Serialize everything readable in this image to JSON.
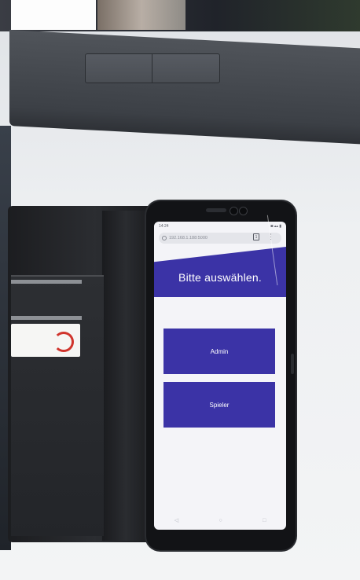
{
  "browser": {
    "url": "192.168.1.188:5000",
    "tab_count": "1",
    "menu_glyph": "⋮",
    "status_time": "14:24",
    "status_icons": "◙ ▴▴ ▮"
  },
  "page": {
    "title": "Bitte auswählen.",
    "buttons": [
      {
        "label": "Admin"
      },
      {
        "label": "Spieler"
      }
    ]
  },
  "android_nav": {
    "back": "◁",
    "home": "○",
    "recents": "□"
  },
  "colors": {
    "accent": "#3b33a6",
    "screen_bg": "#f4f4f8",
    "phone_body": "#121316"
  },
  "icons": [
    "info-icon",
    "tabs-icon",
    "menu-icon",
    "wallet-card-logo-icon"
  ]
}
